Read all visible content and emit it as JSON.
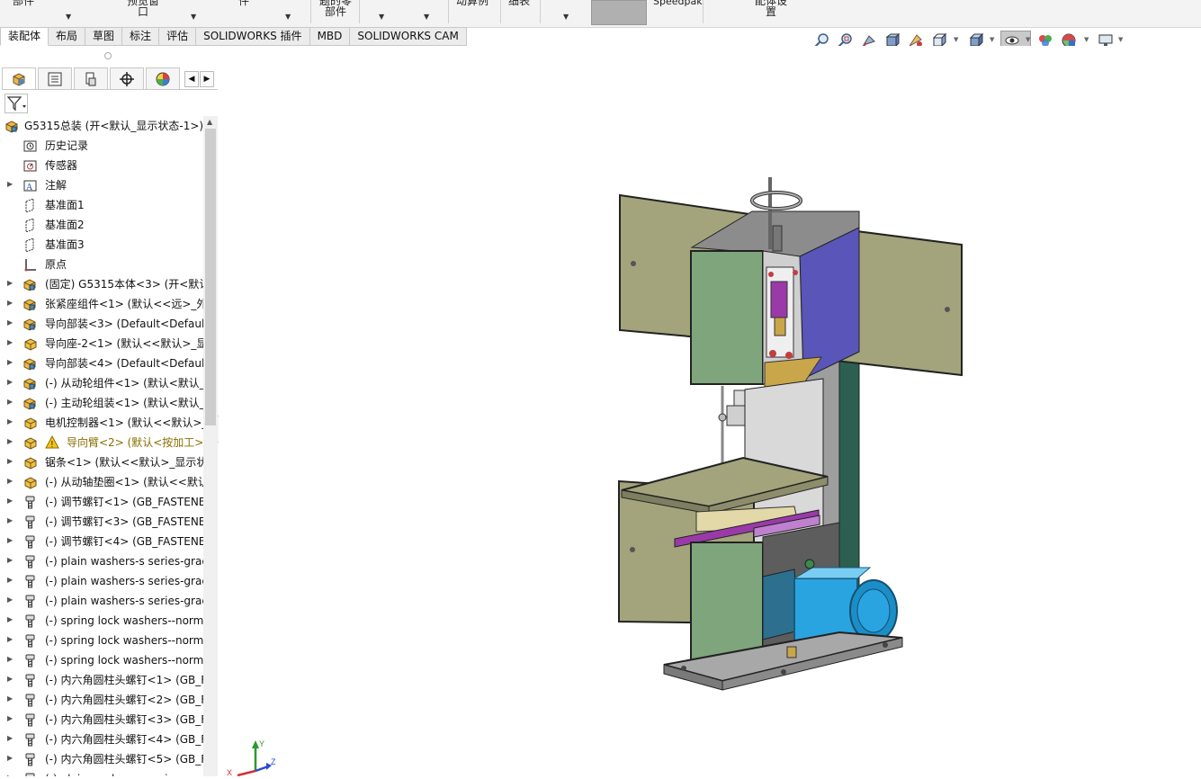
{
  "ribbon": {
    "items": [
      "部件",
      "预览窗\n口",
      "件",
      "题的零\n部件",
      "动算例",
      "细表",
      "Speedpak",
      "配体设\n置"
    ]
  },
  "tabs": [
    "装配体",
    "布局",
    "草图",
    "标注",
    "评估",
    "SOLIDWORKS 插件",
    "MBD",
    "SOLIDWORKS CAM"
  ],
  "heads_up_toolbar": {
    "icons": [
      "zoom-to-fit-icon",
      "zoom-to-area-icon",
      "previous-view-icon",
      "section-view-icon",
      "dynamic-annotation-icon",
      "view-orientation-icon",
      "display-style-icon",
      "hide-show-items-icon",
      "edit-appearance-icon",
      "apply-scene-icon",
      "view-settings-icon"
    ]
  },
  "feature_tree": {
    "panel_tabs": [
      "feature-manager-icon",
      "property-manager-icon",
      "configuration-manager-icon",
      "dimxpert-icon",
      "display-manager-icon"
    ],
    "items": [
      {
        "label": "G5315总装  (开<默认_显示状态-1>)",
        "icon": "assembly-icon",
        "expander": false,
        "indent": 0,
        "warning": false
      },
      {
        "label": "历史记录",
        "icon": "history-icon",
        "expander": false,
        "indent": 1,
        "warning": false
      },
      {
        "label": "传感器",
        "icon": "sensor-icon",
        "expander": false,
        "indent": 1,
        "warning": false
      },
      {
        "label": "注解",
        "icon": "annotation-icon",
        "expander": true,
        "indent": 1,
        "warning": false
      },
      {
        "label": "基准面1",
        "icon": "plane-icon",
        "expander": false,
        "indent": 1,
        "warning": false
      },
      {
        "label": "基准面2",
        "icon": "plane-icon",
        "expander": false,
        "indent": 1,
        "warning": false
      },
      {
        "label": "基准面3",
        "icon": "plane-icon",
        "expander": false,
        "indent": 1,
        "warning": false
      },
      {
        "label": "原点",
        "icon": "origin-icon",
        "expander": false,
        "indent": 1,
        "warning": false
      },
      {
        "label": "(固定) G5315本体<3> (开<默认",
        "icon": "subassembly-icon",
        "expander": true,
        "indent": 1,
        "warning": false
      },
      {
        "label": "张紧座组件<1> (默认<<远>_外",
        "icon": "subassembly-icon",
        "expander": true,
        "indent": 1,
        "warning": false
      },
      {
        "label": "导向部装<3> (Default<Default_",
        "icon": "subassembly-icon",
        "expander": true,
        "indent": 1,
        "warning": false
      },
      {
        "label": "导向座-2<1> (默认<<默认>_显",
        "icon": "part-icon",
        "expander": true,
        "indent": 1,
        "warning": false
      },
      {
        "label": "导向部装<4> (Default<Default_",
        "icon": "subassembly-icon",
        "expander": true,
        "indent": 1,
        "warning": false
      },
      {
        "label": "(-) 从动轮组件<1> (默认<默认_",
        "icon": "subassembly-icon",
        "expander": true,
        "indent": 1,
        "warning": false
      },
      {
        "label": "(-) 主动轮组装<1> (默认<默认_",
        "icon": "subassembly-icon",
        "expander": true,
        "indent": 1,
        "warning": false
      },
      {
        "label": "电机控制器<1> (默认<<默认>_",
        "icon": "part-icon",
        "expander": true,
        "indent": 1,
        "warning": false
      },
      {
        "label": "导向臂<2> (默认<按加工>",
        "icon": "part-icon",
        "expander": true,
        "indent": 1,
        "warning": true
      },
      {
        "label": "锯条<1> (默认<<默认>_显示状",
        "icon": "part-icon",
        "expander": true,
        "indent": 1,
        "warning": false
      },
      {
        "label": "(-) 从动轴垫圈<1> (默认<<默认",
        "icon": "part-icon",
        "expander": true,
        "indent": 1,
        "warning": false
      },
      {
        "label": "(-) 调节螺钉<1> (GB_FASTENEI",
        "icon": "fastener-icon",
        "expander": true,
        "indent": 1,
        "warning": false
      },
      {
        "label": "(-) 调节螺钉<3> (GB_FASTENEI",
        "icon": "fastener-icon",
        "expander": true,
        "indent": 1,
        "warning": false
      },
      {
        "label": "(-) 调节螺钉<4> (GB_FASTENEI",
        "icon": "fastener-icon",
        "expander": true,
        "indent": 1,
        "warning": false
      },
      {
        "label": "(-) plain washers-s series-grac",
        "icon": "fastener-icon",
        "expander": true,
        "indent": 1,
        "warning": false
      },
      {
        "label": "(-) plain washers-s series-grac",
        "icon": "fastener-icon",
        "expander": true,
        "indent": 1,
        "warning": false
      },
      {
        "label": "(-) plain washers-s series-grac",
        "icon": "fastener-icon",
        "expander": true,
        "indent": 1,
        "warning": false
      },
      {
        "label": "(-) spring lock washers--norm",
        "icon": "fastener-icon",
        "expander": true,
        "indent": 1,
        "warning": false
      },
      {
        "label": "(-) spring lock washers--norm",
        "icon": "fastener-icon",
        "expander": true,
        "indent": 1,
        "warning": false
      },
      {
        "label": "(-) spring lock washers--norm",
        "icon": "fastener-icon",
        "expander": true,
        "indent": 1,
        "warning": false
      },
      {
        "label": "(-) 内六角圆柱头螺钉<1> (GB_F",
        "icon": "fastener-icon",
        "expander": true,
        "indent": 1,
        "warning": false
      },
      {
        "label": "(-) 内六角圆柱头螺钉<2> (GB_F",
        "icon": "fastener-icon",
        "expander": true,
        "indent": 1,
        "warning": false
      },
      {
        "label": "(-) 内六角圆柱头螺钉<3> (GB_F",
        "icon": "fastener-icon",
        "expander": true,
        "indent": 1,
        "warning": false
      },
      {
        "label": "(-) 内六角圆柱头螺钉<4> (GB_F",
        "icon": "fastener-icon",
        "expander": true,
        "indent": 1,
        "warning": false
      },
      {
        "label": "(-) 内六角圆柱头螺钉<5> (GB_F",
        "icon": "fastener-icon",
        "expander": true,
        "indent": 1,
        "warning": false
      },
      {
        "label": "(-) plain washers-s series-grac",
        "icon": "fastener-icon",
        "expander": true,
        "indent": 1,
        "warning": false
      }
    ]
  },
  "viewport": {
    "model": "band-saw-assembly-3d",
    "triad_axes": [
      "X",
      "Y",
      "Z"
    ]
  },
  "colors": {
    "door_panel": "#a3a47c",
    "frame_gray": "#a8a8a8",
    "cover_green": "#7fa57c",
    "purple_panel": "#5a55b8",
    "motor_blue": "#2aa4e0",
    "magenta_rail": "#9a3aa8",
    "warning_text": "#8a6d00"
  }
}
